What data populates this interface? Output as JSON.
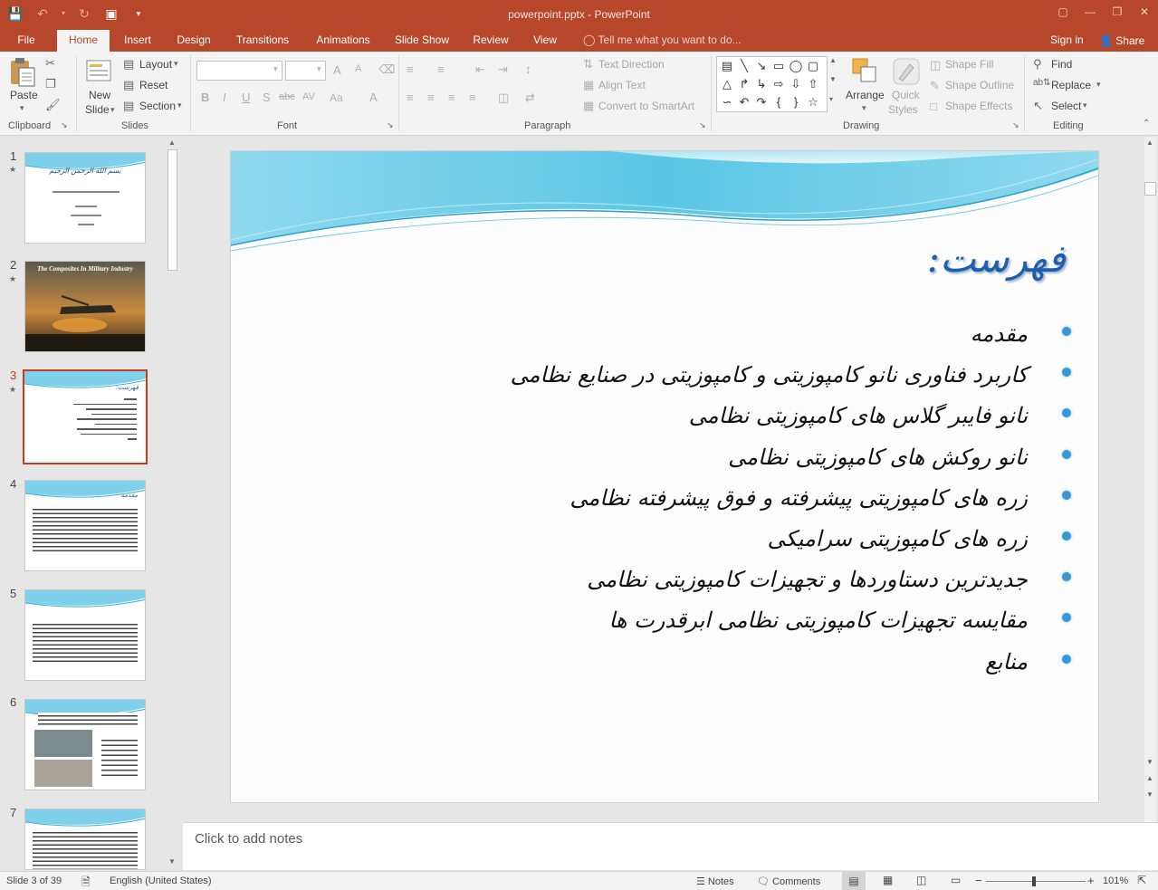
{
  "window": {
    "title": "powerpoint.pptx - PowerPoint",
    "controls": [
      "restore-ribbon",
      "minimize",
      "maximize",
      "close"
    ]
  },
  "tabs": [
    {
      "label": "File"
    },
    {
      "label": "Home"
    },
    {
      "label": "Insert"
    },
    {
      "label": "Design"
    },
    {
      "label": "Transitions"
    },
    {
      "label": "Animations"
    },
    {
      "label": "Slide Show"
    },
    {
      "label": "Review"
    },
    {
      "label": "View"
    }
  ],
  "tell_me": "Tell me what you want to do...",
  "sign_in": "Sign in",
  "share": "Share",
  "ribbon": {
    "clipboard": {
      "label": "Clipboard",
      "paste": "Paste"
    },
    "slides": {
      "label": "Slides",
      "new_slide_1": "New",
      "new_slide_2": "Slide",
      "layout": "Layout",
      "reset": "Reset",
      "section": "Section"
    },
    "font": {
      "label": "Font",
      "bold": "B",
      "italic": "I",
      "underline": "U",
      "shadow": "S",
      "strike": "abc",
      "spacing": "AV",
      "case": "Aa",
      "grow": "A",
      "shrink": "A"
    },
    "paragraph": {
      "label": "Paragraph",
      "text_direction": "Text Direction",
      "align_text": "Align Text",
      "smartart": "Convert to SmartArt"
    },
    "drawing": {
      "label": "Drawing",
      "arrange": "Arrange",
      "quick_styles_1": "Quick",
      "quick_styles_2": "Styles",
      "shape_fill": "Shape Fill",
      "shape_outline": "Shape Outline",
      "shape_effects": "Shape Effects"
    },
    "editing": {
      "label": "Editing",
      "find": "Find",
      "replace": "Replace",
      "select": "Select"
    }
  },
  "thumbnails": [
    {
      "num": "1",
      "title": "بسم الله الرحمن الرحیم"
    },
    {
      "num": "2",
      "title": "The Composites In Military Industry"
    },
    {
      "num": "3",
      "title": "فهرست:"
    },
    {
      "num": "4",
      "title": "مقدمه"
    },
    {
      "num": "5",
      "title": ""
    },
    {
      "num": "6",
      "title": ""
    },
    {
      "num": "7",
      "title": ""
    }
  ],
  "slide": {
    "title": "فهرست:",
    "bullets": [
      "مقدمه",
      "کاربرد فناوری نانو کامپوزیتی و کامپوزیتی در صنایع نظامی",
      "نانو فایبر گلاس های کامپوزیتی نظامی",
      "نانو روکش های کامپوزیتی نظامی",
      "زره های کامپوزیتی پیشرفته و فوق پیشرفته نظامی",
      "زره های کامپوزیتی سرامیکی",
      "جدیدترین دستاوردها و تجهیزات کامپوزیتی نظامی",
      "مقایسه تجهیزات کامپوزیتی نظامی ابرقدرت ها",
      "منابع"
    ],
    "bullet_color": "#3a97d6",
    "title_color": "#1f5fa8"
  },
  "notes_placeholder": "Click to add notes",
  "status": {
    "slide_of": "Slide 3 of 39",
    "language": "English (United States)",
    "notes": "Notes",
    "comments": "Comments",
    "zoom": "101%"
  },
  "colors": {
    "accent": "#b7472a",
    "selected_thumb": "#c43e1c"
  }
}
